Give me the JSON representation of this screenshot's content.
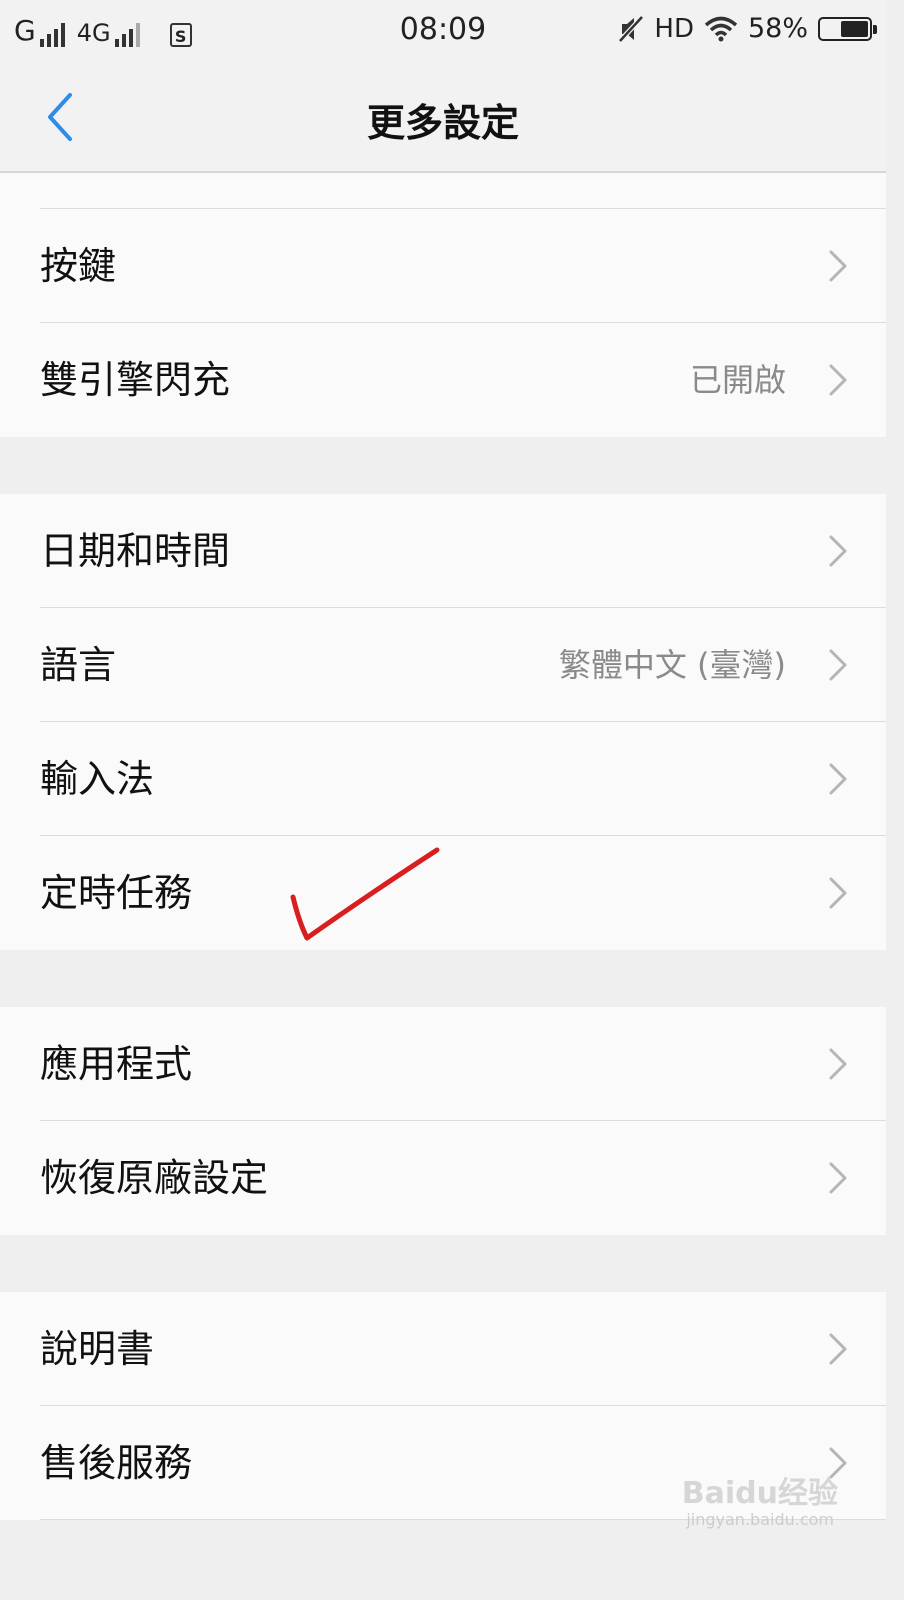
{
  "status_bar": {
    "carrier1": "G",
    "carrier2": "4G",
    "sim_icon": "S",
    "time": "08:09",
    "hd": "HD",
    "battery": "58%",
    "battery_level": 0.58
  },
  "header": {
    "title": "更多設定"
  },
  "groups": [
    [
      {
        "label": "按鍵",
        "value": ""
      },
      {
        "label": "雙引擎閃充",
        "value": "已開啟"
      }
    ],
    [
      {
        "label": "日期和時間",
        "value": ""
      },
      {
        "label": "語言",
        "value": "繁體中文 (臺灣)"
      },
      {
        "label": "輸入法",
        "value": ""
      },
      {
        "label": "定時任務",
        "value": ""
      }
    ],
    [
      {
        "label": "應用程式",
        "value": ""
      },
      {
        "label": "恢復原廠設定",
        "value": ""
      }
    ],
    [
      {
        "label": "說明書",
        "value": ""
      },
      {
        "label": "售後服務",
        "value": ""
      }
    ]
  ],
  "watermark": {
    "text": "Baidu经验",
    "sub": "jingyan.baidu.com"
  },
  "colors": {
    "accent": "#2f8be8",
    "annotation": "#d81e1e"
  }
}
